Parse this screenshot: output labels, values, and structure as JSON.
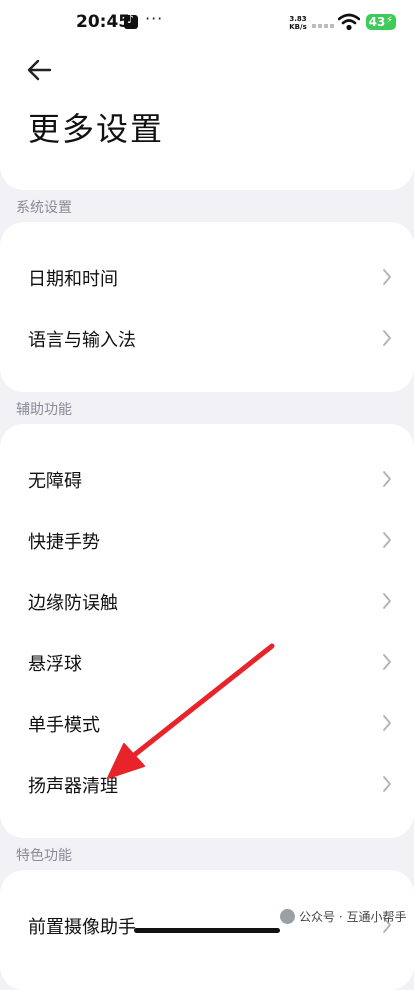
{
  "status_bar": {
    "time": "20:45",
    "more": "···",
    "net_speed_value": "3.83",
    "net_speed_unit": "KB/s",
    "battery": "43"
  },
  "header": {
    "title": "更多设置",
    "back_icon": "arrow-left-icon"
  },
  "sections": [
    {
      "label": "系统设置",
      "items": [
        "日期和时间",
        "语言与输入法"
      ]
    },
    {
      "label": "辅助功能",
      "items": [
        "无障碍",
        "快捷手势",
        "边缘防误触",
        "悬浮球",
        "单手模式",
        "扬声器清理"
      ]
    },
    {
      "label": "特色功能",
      "items": [
        "前置摄像助手"
      ]
    }
  ],
  "watermark": "公众号 · 互通小帮手",
  "colors": {
    "background": "#f1f1f6",
    "card": "#ffffff",
    "section_label": "#8a8a96",
    "annotation_arrow": "#e8232a",
    "battery": "#3ecb5a"
  }
}
